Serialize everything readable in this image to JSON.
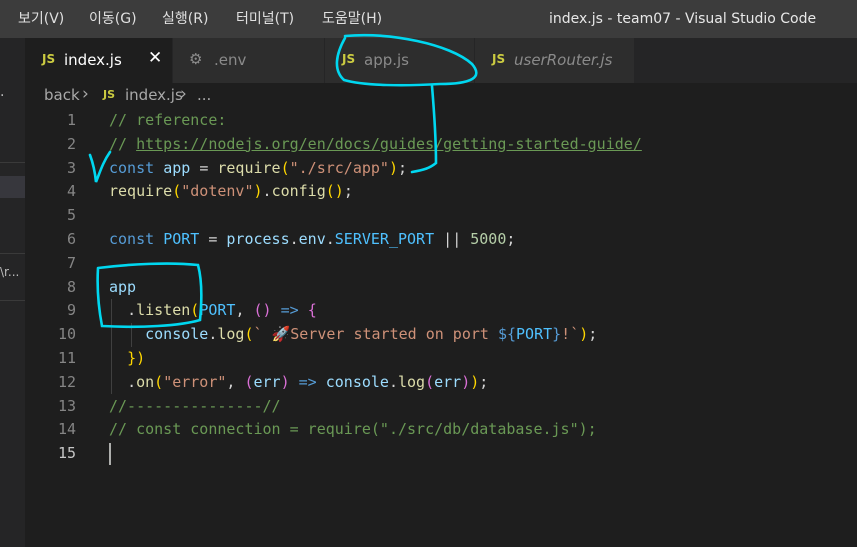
{
  "menu": {
    "view": "보기(V)",
    "go": "이동(G)",
    "run": "실행(R)",
    "terminal": "터미널(T)",
    "help": "도움말(H)"
  },
  "window_title": "index.js - team07 - Visual Studio Code",
  "sidebar": {
    "dot": "·",
    "fragment": "\\r..."
  },
  "tabs": [
    {
      "label": "index.js",
      "icon": "JS",
      "active": true
    },
    {
      "label": ".env",
      "icon": "gear-icon"
    },
    {
      "label": "app.js",
      "icon": "JS"
    },
    {
      "label": "userRouter.js",
      "icon": "JS"
    }
  ],
  "tab_close": "✕",
  "breadcrumb": {
    "folder": "back",
    "sep": "›",
    "file_icon": "JS",
    "file": "index.js",
    "more": "..."
  },
  "editor": {
    "line_numbers": [
      "1",
      "2",
      "3",
      "4",
      "5",
      "6",
      "7",
      "8",
      "9",
      "10",
      "11",
      "12",
      "13",
      "14",
      "15"
    ],
    "lines": [
      "// reference:",
      "// https://nodejs.org/en/docs/guides/getting-started-guide/",
      "const app = require(\"./src/app\");",
      "require(\"dotenv\").config();",
      "",
      "const PORT = process.env.SERVER_PORT || 5000;",
      "",
      "app",
      "  .listen(PORT, () => {",
      "    console.log(` 🚀Server started on port ${PORT}!`);",
      "  })",
      "  .on(\"error\", (err) => console.log(err));",
      "//---------------//",
      "// const connection = require(\"./src/db/database.js\");",
      ""
    ],
    "current_line": 15
  },
  "colors": {
    "title_bar": "#3c3c3c",
    "editor_bg": "#1e1e1e",
    "annotation_pen": "#00d7f0",
    "comment": "#6a9955",
    "keyword": "#569cd6",
    "string": "#ce9178"
  }
}
